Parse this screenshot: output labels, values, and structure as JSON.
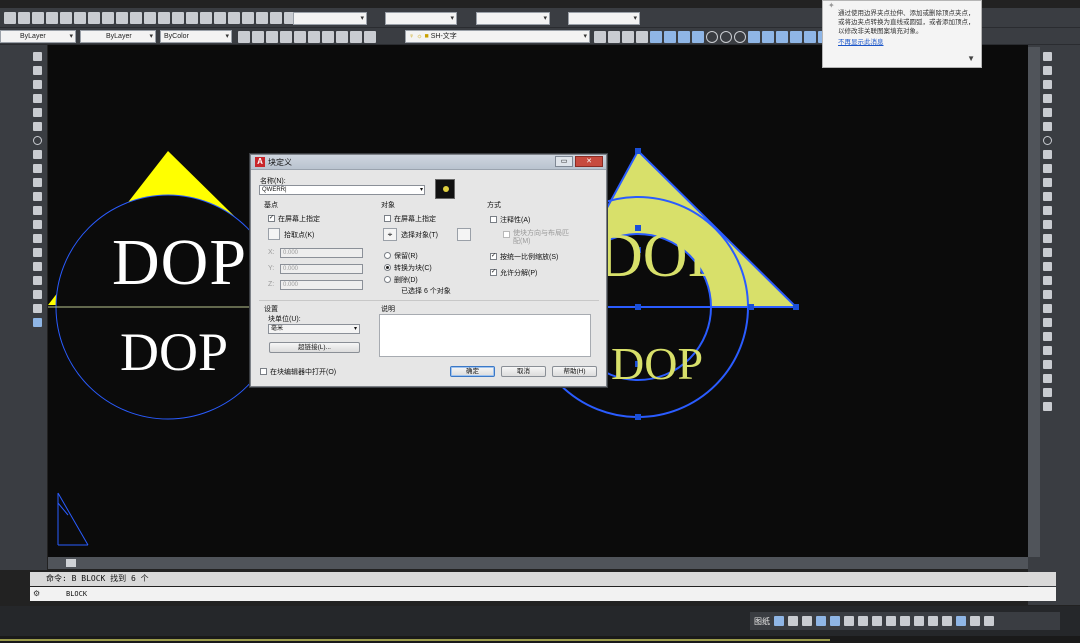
{
  "toolbar": {
    "layer_combo": "ByLayer",
    "linetype_combo": "ByLayer",
    "color_combo": "ByColor",
    "text_style_combo": "SH-文字"
  },
  "balloon": {
    "text": "通过使用边界夹点拉伸、添加或删除顶点夹点，或将边夹点转换为直线或圆弧，或者添加顶点，以修改非关联图案填充对象。",
    "link": "不再显示此消息"
  },
  "canvas": {
    "left_top_text": "DOP",
    "left_bottom_text": "DOP",
    "right_top_text": "DOP",
    "right_bottom_text": "DOP",
    "colors": {
      "yellow": "#ffff00",
      "blue": "#2a5cff",
      "grip": "#1a4fd8",
      "yellow_green": "#d8e06a"
    }
  },
  "dialog": {
    "title": "块定义",
    "name_label": "名称(N):",
    "name_value": "QWERR|",
    "basepoint": {
      "group_label": "基点",
      "specify_on_screen": "在屏幕上指定",
      "pick_point": "拾取点(K)",
      "x_label": "X:",
      "x_value": "0.000",
      "y_label": "Y:",
      "y_value": "0.000",
      "z_label": "Z:",
      "z_value": "0.000"
    },
    "objects": {
      "group_label": "对象",
      "specify_on_screen": "在屏幕上指定",
      "select_objects": "选择对象(T)",
      "retain": "保留(R)",
      "convert_to_block": "转换为块(C)",
      "delete": "删除(D)",
      "selected_count": "已选择 6 个对象"
    },
    "behavior": {
      "group_label": "方式",
      "annotative": "注释性(A)",
      "match_orientation": "使块方向与布局匹配(M)",
      "scale_uniformly": "按统一比例缩放(S)",
      "allow_exploding": "允许分解(P)"
    },
    "settings": {
      "group_label": "设置",
      "block_unit_label": "块单位(U):",
      "block_unit_value": "毫米",
      "hyperlink_button": "超链接(L)..."
    },
    "description_label": "说明",
    "open_in_editor": "在块编辑器中打开(O)",
    "ok": "确定",
    "cancel": "取消",
    "help": "帮助(H)"
  },
  "command": {
    "history": "命令: B BLOCK 找到 6 个",
    "prompt": "BLOCK"
  },
  "status": {
    "model_label": "图纸"
  }
}
